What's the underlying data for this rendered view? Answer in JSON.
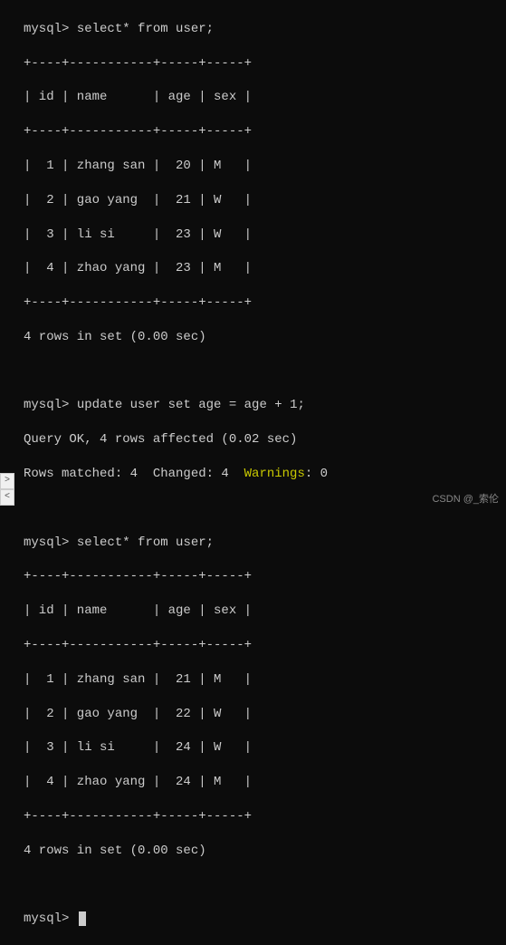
{
  "prompt": "mysql>",
  "commands": {
    "select1": "select* from user;",
    "update": "update user set age = age + 1;",
    "select2": "select* from user;"
  },
  "table1": {
    "border_top": "+----+-----------+-----+-----+",
    "header": "| id | name      | age | sex |",
    "border_mid": "+----+-----------+-----+-----+",
    "rows": [
      "|  1 | zhang san |  20 | M   |",
      "|  2 | gao yang  |  21 | W   |",
      "|  3 | li si     |  23 | W   |",
      "|  4 | zhao yang |  23 | M   |"
    ],
    "border_bot": "+----+-----------+-----+-----+",
    "footer": "4 rows in set (0.00 sec)"
  },
  "update_result": {
    "line1": "Query OK, 4 rows affected (0.02 sec)",
    "line2a": "Rows matched: 4  Changed: 4  ",
    "warnings_label": "Warnings",
    "line2b": ": 0"
  },
  "table2": {
    "border_top": "+----+-----------+-----+-----+",
    "header": "| id | name      | age | sex |",
    "border_mid": "+----+-----------+-----+-----+",
    "rows": [
      "|  1 | zhang san |  21 | M   |",
      "|  2 | gao yang  |  22 | W   |",
      "|  3 | li si     |  24 | W   |",
      "|  4 | zhao yang |  24 | M   |"
    ],
    "border_bot": "+----+-----------+-----+-----+",
    "footer": "4 rows in set (0.00 sec)"
  },
  "scroll": {
    "right": ">",
    "left": "<"
  },
  "watermark": "CSDN @_索伦"
}
